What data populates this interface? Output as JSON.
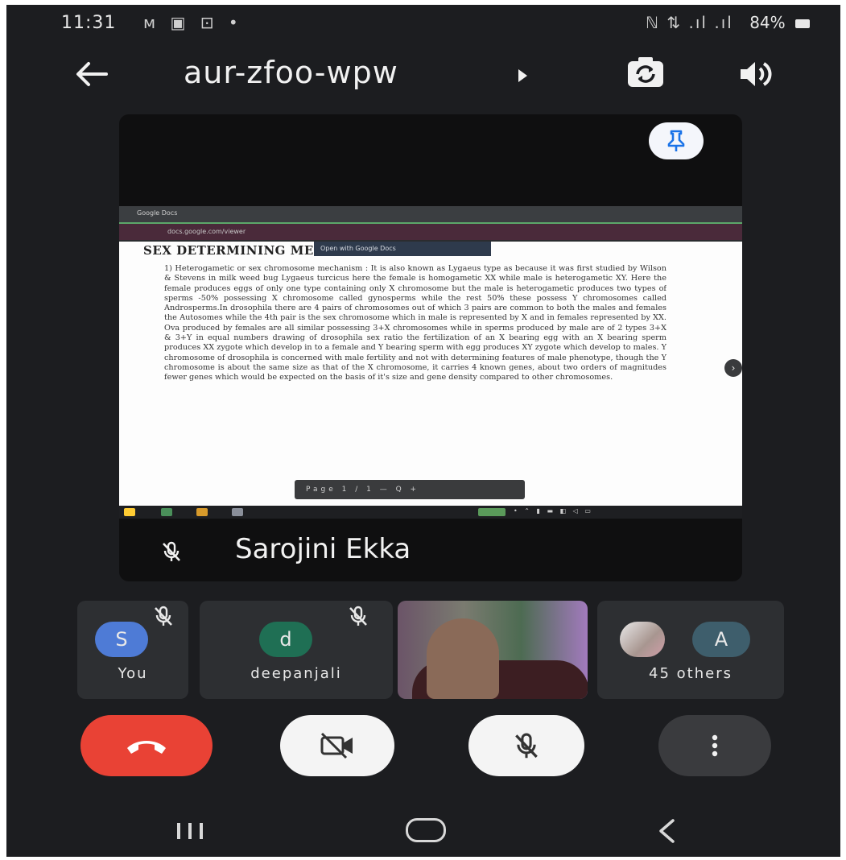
{
  "status_bar": {
    "time": "11:31",
    "notification_icons": "ᴍ ▣ ⊡ •",
    "signal_text": "ℕ ⇅ .ıl .ıl",
    "battery": "84%"
  },
  "header": {
    "meeting_code": "aur-zfoo-wpw"
  },
  "presentation": {
    "browser_tab": "Google Docs",
    "address": "docs.google.com/viewer",
    "popup_text": "Open with Google Docs",
    "doc_title": "SEX DETERMINING MECHANISM",
    "doc_body": "1) Heterogametic or sex chromosome mechanism : It is also known as Lygaeus type as because it was first studied by Wilson & Stevens in milk weed bug Lygaeus turcicus here the female is homogametic XX while male is heterogametic XY. Here the female produces eggs of only one type containing only X chromosome but the male is heterogametic produces two types of sperms -50% possessing X chromosome called gynosperms while the rest 50% these possess Y chromosomes called Androsperms.In drosophila there are 4 pairs of chromosomes out of which 3 pairs are common to both the males and females the Autosomes while the 4th pair is the sex chromosome which in male is represented by X and in females represented by XX. Ova produced by females are all similar possessing 3+X chromosomes while in sperms produced by male are of 2 types 3+X & 3+Y in equal numbers drawing of drosophila sex ratio the fertilization of an X bearing egg with an X bearing sperm produces XX zygote which develop in to a female and Y bearing sperm with egg produces XY zygote which develop to males. Y chromosome of drosophila is concerned with male fertility and not with determining features of male phenotype, though the Y chromosome is about the same size as that of the X chromosome, it carries 4 known genes, about two orders of magnitudes fewer genes which would be expected on the basis of it's size and gene density compared to other chromosomes.",
    "viewer_toolbar": "Page 1 / 1 — Q +",
    "presenter_name": "Sarojini Ekka"
  },
  "participants": [
    {
      "initial": "S",
      "label": "You",
      "color": "#4e7bd6"
    },
    {
      "initial": "d",
      "label": "deepanjali",
      "color": "#1f6f54"
    },
    {
      "initial": "A",
      "label": "45 others",
      "color": "#3e5e6c"
    }
  ],
  "colors": {
    "background": "#1c1d20",
    "hangup": "#e94235",
    "control_light": "#f4f4f4",
    "accent_blue": "#1a73e8"
  },
  "icons": [
    "back-arrow-icon",
    "caret-right-icon",
    "switch-camera-icon",
    "speaker-icon",
    "pin-icon",
    "mic-off-icon",
    "phone-hangup-icon",
    "camera-off-icon",
    "more-vert-icon",
    "nav-recent-icon",
    "nav-home-icon",
    "nav-back-icon"
  ]
}
